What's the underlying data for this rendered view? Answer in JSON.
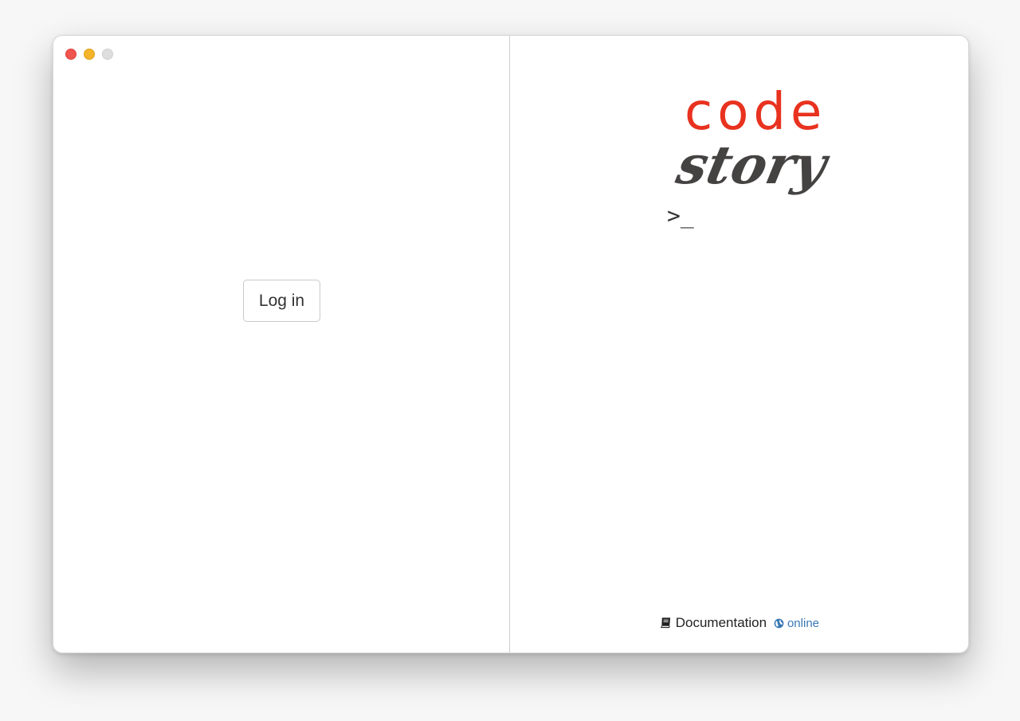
{
  "window": {
    "controls": [
      "close",
      "minimize",
      "maximize"
    ]
  },
  "left_pane": {
    "login_label": "Log in"
  },
  "logo": {
    "code": "code",
    "story": "story",
    "prompt": ">_"
  },
  "footer": {
    "doc_icon": "book-icon",
    "doc_label": "Documentation",
    "online_icon": "globe-icon",
    "online_label": "online"
  },
  "colors": {
    "brand_red": "#e8321f",
    "logo_dark": "#454242",
    "link_blue": "#3a78b4"
  }
}
